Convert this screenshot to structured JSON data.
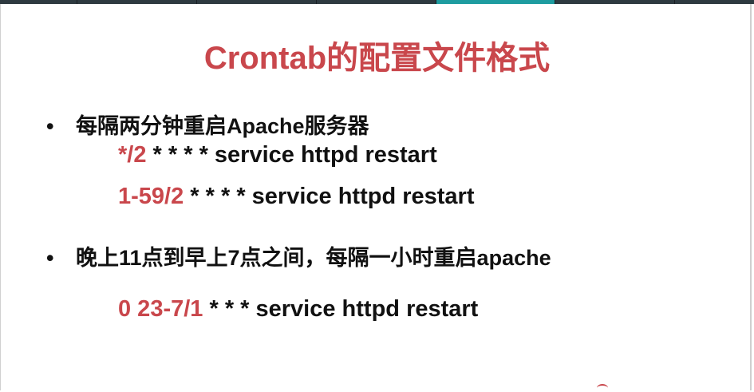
{
  "top_bar": {
    "segments": [
      {
        "color": "#2e3a40"
      },
      {
        "color": "#2e3a40"
      },
      {
        "color": "#2e3a40"
      },
      {
        "color": "#2e3a40"
      },
      {
        "color": "#1e9ca0"
      },
      {
        "color": "#2e3a40"
      },
      {
        "color": "#2e3a40"
      }
    ]
  },
  "slide": {
    "title": "Crontab的配置文件格式",
    "accent_color": "#c9474c",
    "bullets": [
      {
        "dot": "•",
        "text": "每隔两分钟重启Apache服务器",
        "examples": [
          {
            "highlight": "*/2",
            "rest": " * * * * service httpd restart"
          },
          {
            "highlight": "1-59/2",
            "rest": " * * * * service httpd restart"
          }
        ]
      },
      {
        "dot": "•",
        "text": "晚上11点到早上7点之间，每隔一小时重启apache",
        "examples": [
          {
            "highlight": "0 23-7/1",
            "rest": " * * * service httpd restart"
          }
        ]
      }
    ]
  }
}
